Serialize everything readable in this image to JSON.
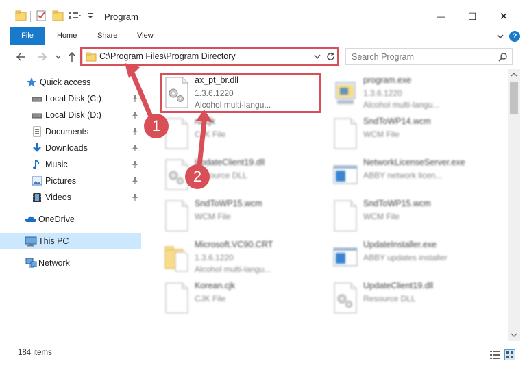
{
  "window": {
    "title": "Program",
    "minimize_glyph": "—",
    "maximize_glyph": "☐",
    "close_glyph": "✕"
  },
  "ribbon": {
    "tabs": [
      "File",
      "Home",
      "Share",
      "View"
    ]
  },
  "address_bar": {
    "path": "C:\\Program Files\\Program Directory"
  },
  "search": {
    "placeholder": "Search Program"
  },
  "sidebar": {
    "items": [
      {
        "label": "Quick access",
        "icon": "star-icon",
        "pinned": false
      },
      {
        "label": "Local Disk (C:)",
        "icon": "drive-icon",
        "pinned": true
      },
      {
        "label": "Local Disk (D:)",
        "icon": "drive-icon",
        "pinned": true
      },
      {
        "label": "Documents",
        "icon": "documents-icon",
        "pinned": true
      },
      {
        "label": "Downloads",
        "icon": "download-icon",
        "pinned": true
      },
      {
        "label": "Music",
        "icon": "music-icon",
        "pinned": true
      },
      {
        "label": "Pictures",
        "icon": "pictures-icon",
        "pinned": true
      },
      {
        "label": "Videos",
        "icon": "videos-icon",
        "pinned": true
      },
      {
        "label": "OneDrive",
        "icon": "cloud-icon",
        "pinned": false
      },
      {
        "label": "This PC",
        "icon": "computer-icon",
        "pinned": false,
        "selected": true
      },
      {
        "label": "Network",
        "icon": "network-icon",
        "pinned": false
      }
    ]
  },
  "files": [
    {
      "name": "ax_pt_br.dll",
      "line1": "1.3.6.1220",
      "line2": "Alcohol multi-langu...",
      "icon": "dll-icon"
    },
    {
      "name": "program.exe",
      "line1": "1.3.6.1220",
      "line2": "Alcohol multi-langu...",
      "icon": "exe-icon"
    },
    {
      "name": "ru.cjk",
      "line1": "CJK File",
      "line2": "",
      "icon": "file-icon"
    },
    {
      "name": "SndToWP14.wcm",
      "line1": "WCM File",
      "line2": "",
      "icon": "file-icon"
    },
    {
      "name": "UpdateClient19.dll",
      "line1": "Resource DLL",
      "line2": "",
      "icon": "dll-icon"
    },
    {
      "name": "NetworkLicenseServer.exe",
      "line1": "ABBY network licen...",
      "line2": "",
      "icon": "app-window-icon"
    },
    {
      "name": "SndToWP15.wcm",
      "line1": "WCM File",
      "line2": "",
      "icon": "file-icon"
    },
    {
      "name": "SndToWP15.wcm",
      "line1": "WCM File",
      "line2": "",
      "icon": "file-icon"
    },
    {
      "name": "Microsoft.VC90.CRT",
      "line1": "1.3.6.1220",
      "line2": "Alcohol multi-langu...",
      "icon": "folder-doc-icon"
    },
    {
      "name": "UpdateInstaller.exe",
      "line1": "ABBY updates installer",
      "line2": "",
      "icon": "app-window-icon"
    },
    {
      "name": "Korean.cjk",
      "line1": "CJK File",
      "line2": "",
      "icon": "file-icon"
    },
    {
      "name": "UpdateClient19.dll",
      "line1": "Resource DLL",
      "line2": "",
      "icon": "dll-icon"
    }
  ],
  "status": {
    "item_count": "184 items"
  },
  "annotations": {
    "step1": "1",
    "step2": "2"
  },
  "colors": {
    "accent": "#1979ca",
    "highlight": "#d94f58",
    "selected_bg": "#cce8ff"
  }
}
